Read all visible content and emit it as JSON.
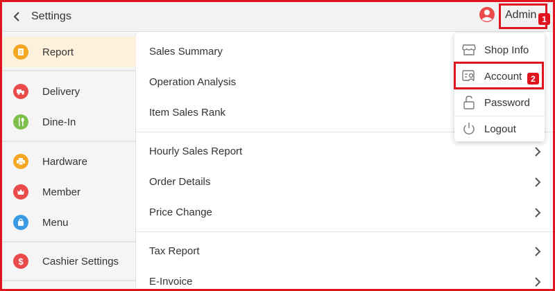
{
  "header": {
    "title": "Settings",
    "user_name": "Admin",
    "icons": {
      "back": "chevron-left-icon",
      "user": "user-circle-icon"
    },
    "annotations": [
      "1",
      "2"
    ]
  },
  "sidebar": {
    "items": [
      {
        "label": "Report",
        "icon": "report-icon",
        "color": "#f5a623",
        "active": true
      },
      {
        "label": "Delivery",
        "icon": "delivery-icon",
        "color": "#e94b4b"
      },
      {
        "label": "Dine-In",
        "icon": "dine-in-icon",
        "color": "#7cc04b"
      },
      {
        "label": "Hardware",
        "icon": "printer-icon",
        "color": "#f5a623"
      },
      {
        "label": "Member",
        "icon": "member-icon",
        "color": "#e94b4b"
      },
      {
        "label": "Menu",
        "icon": "menu-bag-icon",
        "color": "#3b9ae1"
      },
      {
        "label": "Cashier Settings",
        "icon": "dollar-icon",
        "color": "#e94b4b"
      }
    ]
  },
  "main": {
    "rows": [
      {
        "label": "Sales Summary"
      },
      {
        "label": "Operation Analysis"
      },
      {
        "label": "Item Sales Rank"
      },
      {
        "label": "Hourly Sales Report"
      },
      {
        "label": "Order Details"
      },
      {
        "label": "Price Change"
      },
      {
        "label": "Tax Report"
      },
      {
        "label": "E-Invoice"
      }
    ]
  },
  "dropdown": {
    "items": [
      {
        "label": "Shop Info",
        "icon": "shop-icon"
      },
      {
        "label": "Account",
        "icon": "account-card-icon"
      },
      {
        "label": "Password",
        "icon": "unlock-icon"
      },
      {
        "label": "Logout",
        "icon": "power-icon"
      }
    ]
  },
  "colors": {
    "highlight": "#e0141e",
    "active_bg": "#fdf1dc",
    "topbar_bg": "#f2f2f2"
  }
}
